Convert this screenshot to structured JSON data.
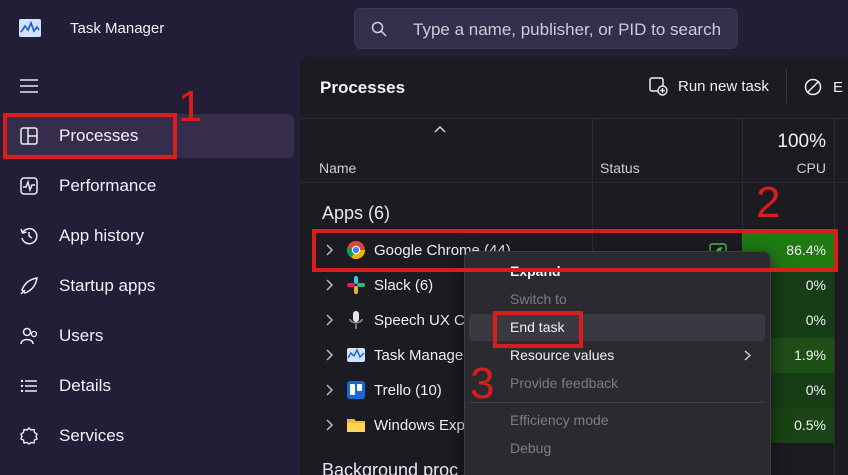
{
  "window": {
    "title": "Task Manager"
  },
  "search": {
    "placeholder": "Type a name, publisher, or PID to search"
  },
  "sidebar": {
    "items": [
      {
        "label": "Processes",
        "icon": "processes-icon",
        "active": true
      },
      {
        "label": "Performance",
        "icon": "performance-icon"
      },
      {
        "label": "App history",
        "icon": "history-icon"
      },
      {
        "label": "Startup apps",
        "icon": "startup-icon"
      },
      {
        "label": "Users",
        "icon": "users-icon"
      },
      {
        "label": "Details",
        "icon": "details-icon"
      },
      {
        "label": "Services",
        "icon": "services-icon"
      }
    ]
  },
  "main": {
    "title": "Processes",
    "toolbar": {
      "run_new_task": "Run new task",
      "end_task_partial": "E"
    },
    "columns": {
      "name": "Name",
      "status": "Status",
      "cpu_total": "100%",
      "cpu": "CPU"
    },
    "group_apps": "Apps (6)",
    "group_background": "Background proc",
    "rows": [
      {
        "name": "Google Chrome (44)",
        "cpu": "86.4%",
        "icon": "chrome-icon"
      },
      {
        "name": "Slack (6)",
        "cpu": "0%",
        "icon": "slack-icon"
      },
      {
        "name": "Speech UX Co",
        "cpu": "0%",
        "icon": "microphone-icon"
      },
      {
        "name": "Task Manager",
        "cpu": "1.9%",
        "icon": "task-manager-icon"
      },
      {
        "name": "Trello (10)",
        "cpu": "0%",
        "icon": "trello-icon"
      },
      {
        "name": "Windows Exp",
        "cpu": "0.5%",
        "icon": "folder-icon"
      }
    ]
  },
  "context_menu": {
    "items": [
      {
        "label": "Expand",
        "bold": true
      },
      {
        "label": "Switch to",
        "disabled": true
      },
      {
        "label": "End task"
      },
      {
        "label": "Resource values",
        "submenu": true
      },
      {
        "label": "Provide feedback",
        "disabled": true
      },
      {
        "label": "Efficiency mode",
        "disabled": true
      },
      {
        "label": "Debug",
        "disabled": true
      }
    ]
  },
  "annotations": {
    "n1": "1",
    "n2": "2",
    "n3": "3"
  },
  "colors": {
    "annotation": "#d81d1d",
    "cpu_high": "#1f7a12",
    "cpu_low": "#173d16",
    "accent": "#352d4b"
  }
}
